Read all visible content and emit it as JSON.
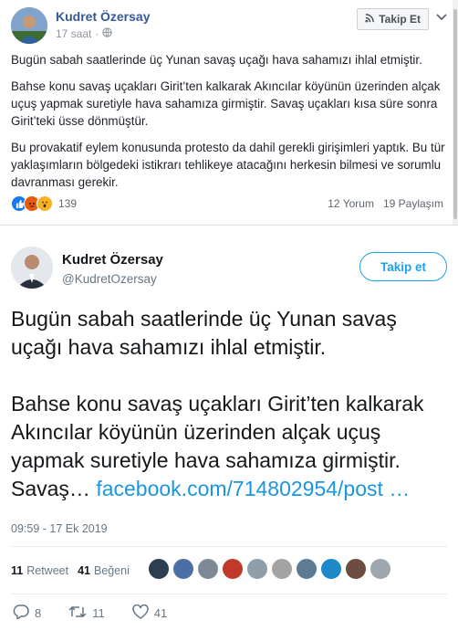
{
  "facebook": {
    "author": "Kudret Özersay",
    "time": "17 saat",
    "follow_label": "Takip Et",
    "paragraphs": [
      "Bugün sabah saatlerinde üç Yunan savaş uçağı hava sahamızı ihlal etmiştir.",
      "Bahse konu savaş uçakları Girit’ten kalkarak Akıncılar köyünün üzerinden alçak uçuş yapmak suretiyle hava sahamıza girmiştir. Savaş uçakları kısa süre sonra Girit’teki üsse dönmüştür.",
      "Bu provakatif eylem konusunda protesto da dahil gerekli girişimleri yaptık. Bu tür yaklaşımların bölgedeki istikrarı tehlikeye atacağını herkesin bilmesi ve sorumlu davranması gerekir."
    ],
    "reaction_count": "139",
    "comments": "12 Yorum",
    "shares": "19 Paylaşım",
    "icons": {
      "follow": "rss-icon",
      "privacy": "globe-icon",
      "menu": "chevron-down-icon"
    }
  },
  "tweet": {
    "name": "Kudret Özersay",
    "handle": "@KudretOzersay",
    "follow_label": "Takip et",
    "paragraph1": "Bugün sabah saatlerinde üç Yunan savaş uçağı hava sahamızı ihlal etmiştir.",
    "paragraph2": "Bahse konu savaş uçakları Girit’ten kalkarak Akıncılar köyünün üzerinden alçak uçuş yapmak suretiyle hava sahamıza girmiştir. Savaş…",
    "link": "facebook.com/714802954/post …",
    "timestamp": "09:59 - 17 Ek 2019",
    "retweets_num": "11",
    "retweets_label": "Retweet",
    "likes_num": "41",
    "likes_label": "Beğeni",
    "reply_count": "8",
    "retweet_count": "11",
    "like_count": "41",
    "accent": "#1da1f2"
  }
}
